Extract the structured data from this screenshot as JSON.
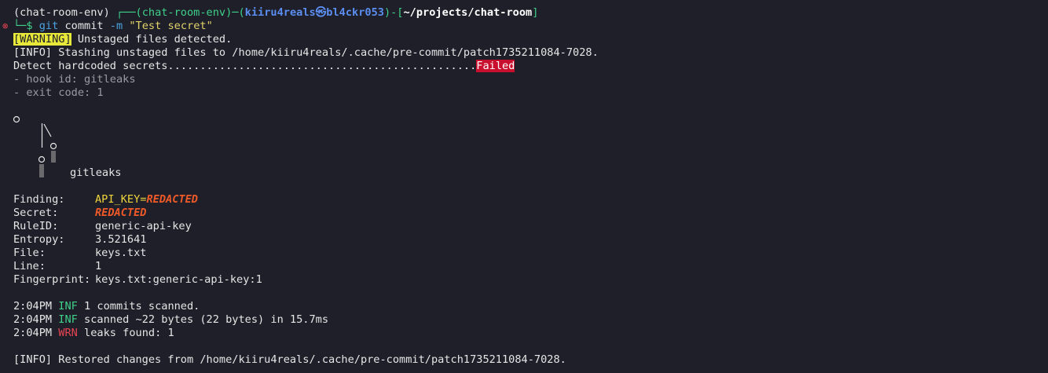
{
  "prompt": {
    "venv": "(chat-room-env)",
    "line_start": " ┌──",
    "venv_bracket": "(chat-room-env)",
    "dash1": "─(",
    "user_host": "kiiru4reals㉿bl4ckr053",
    "dash2": ")-[",
    "path": "~/projects/chat-room",
    "close_bracket": "]",
    "corner": "└─$ ",
    "cmd": "git",
    "arg1": " commit ",
    "flag": "-m",
    "message": " \"Test secret\""
  },
  "output": {
    "warning_tag": "[WARNING]",
    "warning_text": " Unstaged files detected.",
    "stash_info": "[INFO] Stashing unstaged files to /home/kiiru4reals/.cache/pre-commit/patch1735211084-7028.",
    "detect_label": "Detect hardcoded secrets................................................",
    "failed": "Failed",
    "hook_id": "- hook id: gitleaks",
    "exit_code": "- exit code: 1"
  },
  "logo": {
    "name": "gitleaks"
  },
  "finding": {
    "finding_label": "Finding:",
    "finding_key": "API_KEY=",
    "finding_val": "REDACTED",
    "secret_label": "Secret:",
    "secret_val": "REDACTED",
    "rule_label": "RuleID:",
    "rule_val": "generic-api-key",
    "entropy_label": "Entropy:",
    "entropy_val": "3.521641",
    "file_label": "File:",
    "file_val": "keys.txt",
    "line_label": "Line:",
    "line_val": "1",
    "fp_label": "Fingerprint:",
    "fp_val": "keys.txt:generic-api-key:1"
  },
  "logs": [
    {
      "time": "2:04PM",
      "level": "INF",
      "msg": "1 commits scanned."
    },
    {
      "time": "2:04PM",
      "level": "INF",
      "msg": "scanned ~22 bytes (22 bytes) in 15.7ms"
    },
    {
      "time": "2:04PM",
      "level": "WRN",
      "msg": "leaks found: 1"
    }
  ],
  "restore_info": "[INFO] Restored changes from /home/kiiru4reals/.cache/pre-commit/patch1735211084-7028.",
  "colors": {
    "background": "#1e1f29",
    "warning_bg": "#e8e83a",
    "failed_bg": "#c8102e",
    "inf": "#3fd18a",
    "wrn": "#e64553",
    "redacted": "#f05a28"
  }
}
